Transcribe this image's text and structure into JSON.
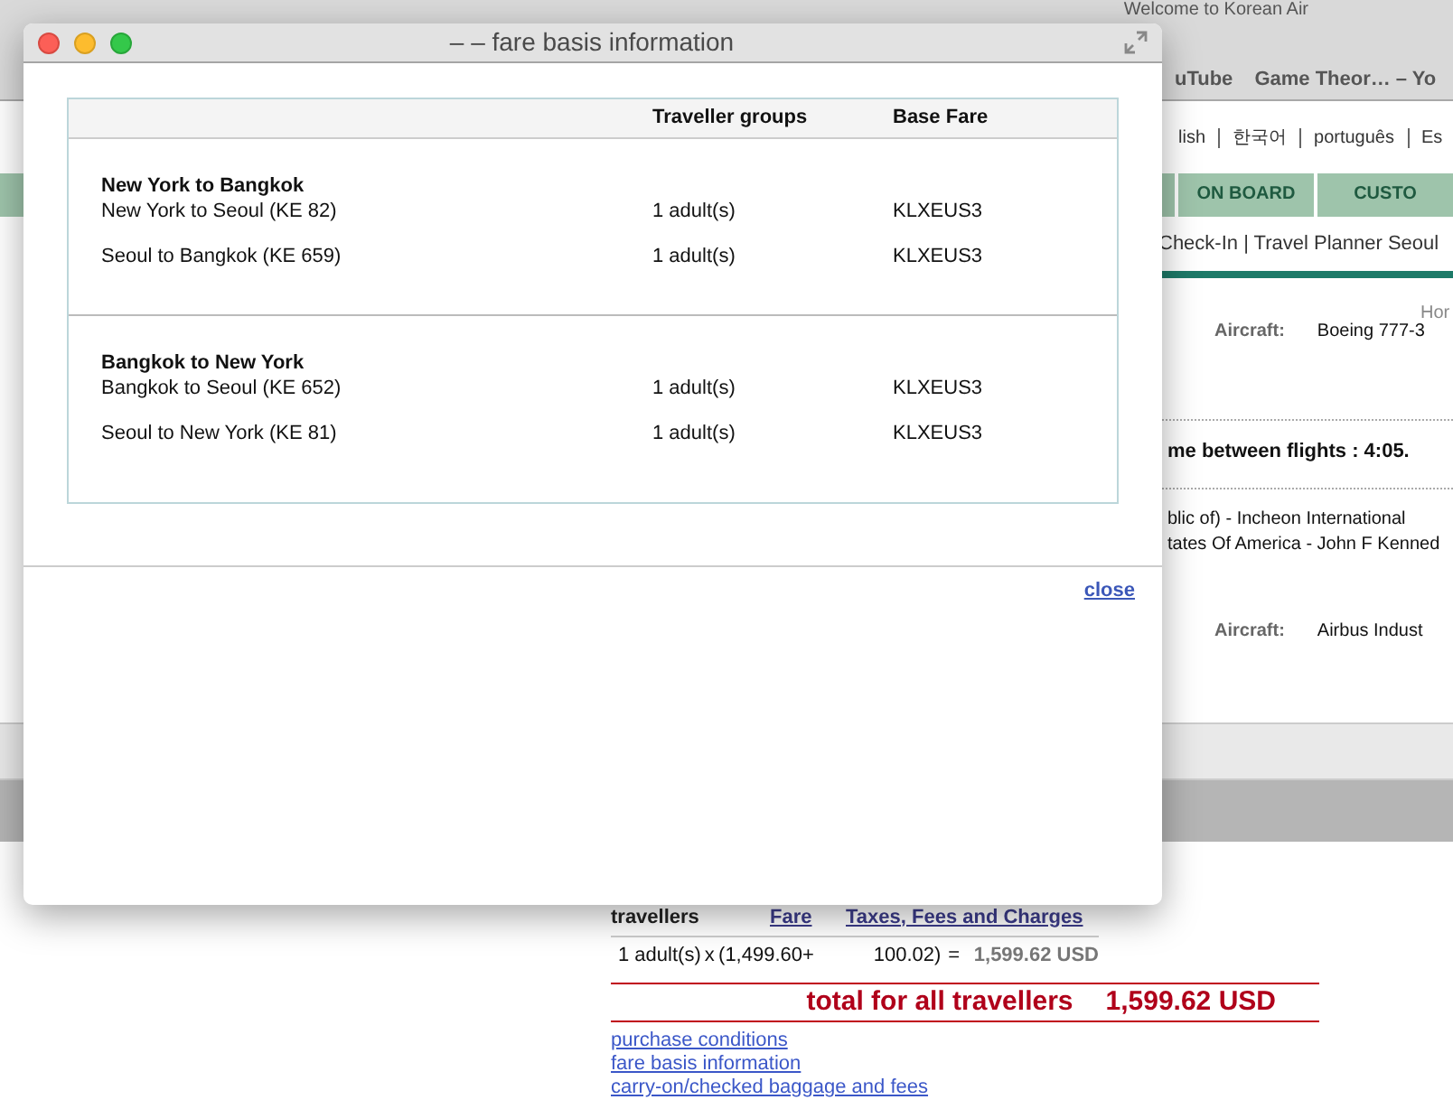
{
  "browser": {
    "title": "Welcome to Korean Air",
    "bookmarks": [
      "uTube",
      "Game Theor… – Yo"
    ]
  },
  "page": {
    "languages": [
      "lish",
      "한국어",
      "português",
      "Es"
    ],
    "nav_tabs": [
      "ON BOARD",
      "CUSTO"
    ],
    "subnav": "Check-In | Travel Planner Seoul",
    "breadcrumb": "Hor",
    "flight_1": {
      "aircraft_label": "Aircraft:",
      "aircraft": "Boeing 777-3"
    },
    "connection": "me between flights : 4:05.",
    "airports": [
      "blic of) - Incheon International",
      "tates Of America - John F Kenned"
    ],
    "flight_2": {
      "aircraft_label": "Aircraft:",
      "aircraft": "Airbus Indust"
    },
    "price": {
      "headings": [
        "travellers",
        "Fare",
        "Taxes, Fees and Charges"
      ],
      "row": {
        "travellers": "1 adult(s)",
        "times": "x",
        "fare": "(1,499.60",
        "plus": "+",
        "taxes": "100.02)",
        "equals": "=",
        "amount": "1,599.62 USD"
      },
      "total_label": "total for all travellers",
      "total": "1,599.62 USD"
    },
    "links": [
      "purchase conditions",
      "fare basis information",
      "carry-on/checked baggage and fees"
    ]
  },
  "dialog": {
    "title": "– – fare basis information",
    "columns": [
      "Traveller groups",
      "Base Fare"
    ],
    "groups": [
      {
        "title": "New York to Bangkok",
        "segments": [
          {
            "route": "New York to Seoul (KE 82)",
            "travellers": "1 adult(s)",
            "fare": "KLXEUS3"
          },
          {
            "route": "Seoul to Bangkok (KE 659)",
            "travellers": "1 adult(s)",
            "fare": "KLXEUS3"
          }
        ]
      },
      {
        "title": "Bangkok to New York",
        "segments": [
          {
            "route": "Bangkok to Seoul (KE 652)",
            "travellers": "1 adult(s)",
            "fare": "KLXEUS3"
          },
          {
            "route": "Seoul to New York (KE 81)",
            "travellers": "1 adult(s)",
            "fare": "KLXEUS3"
          }
        ]
      }
    ],
    "close": "close"
  }
}
